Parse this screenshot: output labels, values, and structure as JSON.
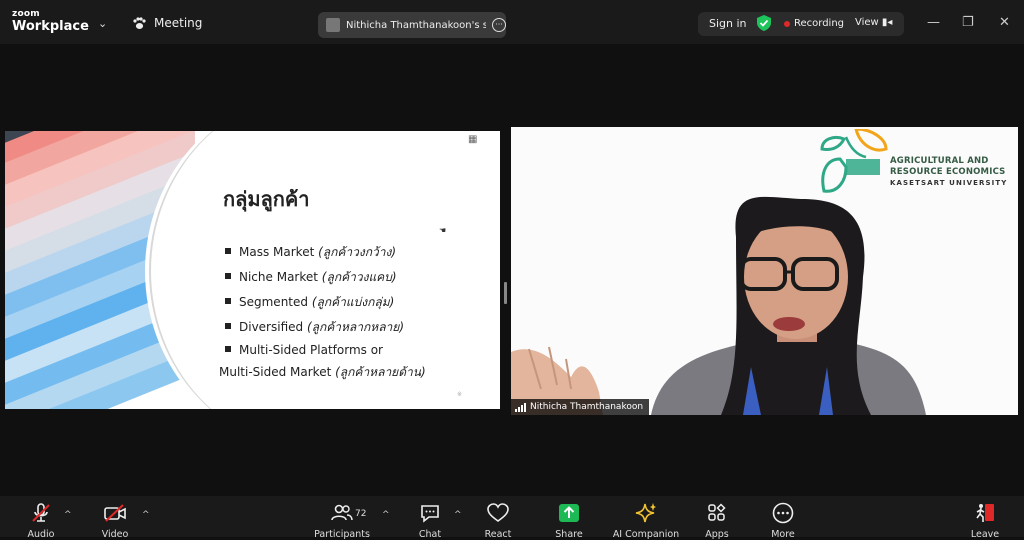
{
  "app": {
    "logo_small": "zoom",
    "logo_big": "Workplace",
    "meeting_label": "Meeting",
    "share_title": "Nithicha Thamthanakoon's screen",
    "sign_in": "Sign in",
    "recording": "Recording",
    "view": "View"
  },
  "slide": {
    "title": "กลุ่มลูกค้า",
    "bullets": [
      {
        "text": "Mass Market ",
        "italic": "(ลูกค้าวงกว้าง)"
      },
      {
        "text": "Niche Market ",
        "italic": "(ลูกค้าวงแคบ)"
      },
      {
        "text": "Segmented ",
        "italic": "(ลูกค้าแบ่งกลุ่ม)"
      },
      {
        "text": "Diversified ",
        "italic": "(ลูกค้าหลากหลาย)"
      },
      {
        "text": "Multi-Sided Platforms or",
        "italic": ""
      }
    ],
    "bullet_cont": {
      "text": "Multi-Sided Market ",
      "italic": "(ลูกค้าหลายด้าน)"
    }
  },
  "video": {
    "brand_line1": "AGRICULTURAL AND",
    "brand_line2": "RESOURCE ECONOMICS",
    "brand_line3": "KASETSART UNIVERSITY",
    "participant_name": "Nithicha Thamthanakoon"
  },
  "toolbar": {
    "audio": "Audio",
    "video": "Video",
    "participants": "Participants",
    "participant_count": "72",
    "chat": "Chat",
    "react": "React",
    "share": "Share",
    "ai_companion": "AI Companion",
    "apps": "Apps",
    "more": "More",
    "leave": "Leave"
  },
  "colors": {
    "share_green": "#1db954",
    "leave_red": "#e02828",
    "shield_green": "#1dc45c",
    "ai_star": "#f2c230"
  }
}
